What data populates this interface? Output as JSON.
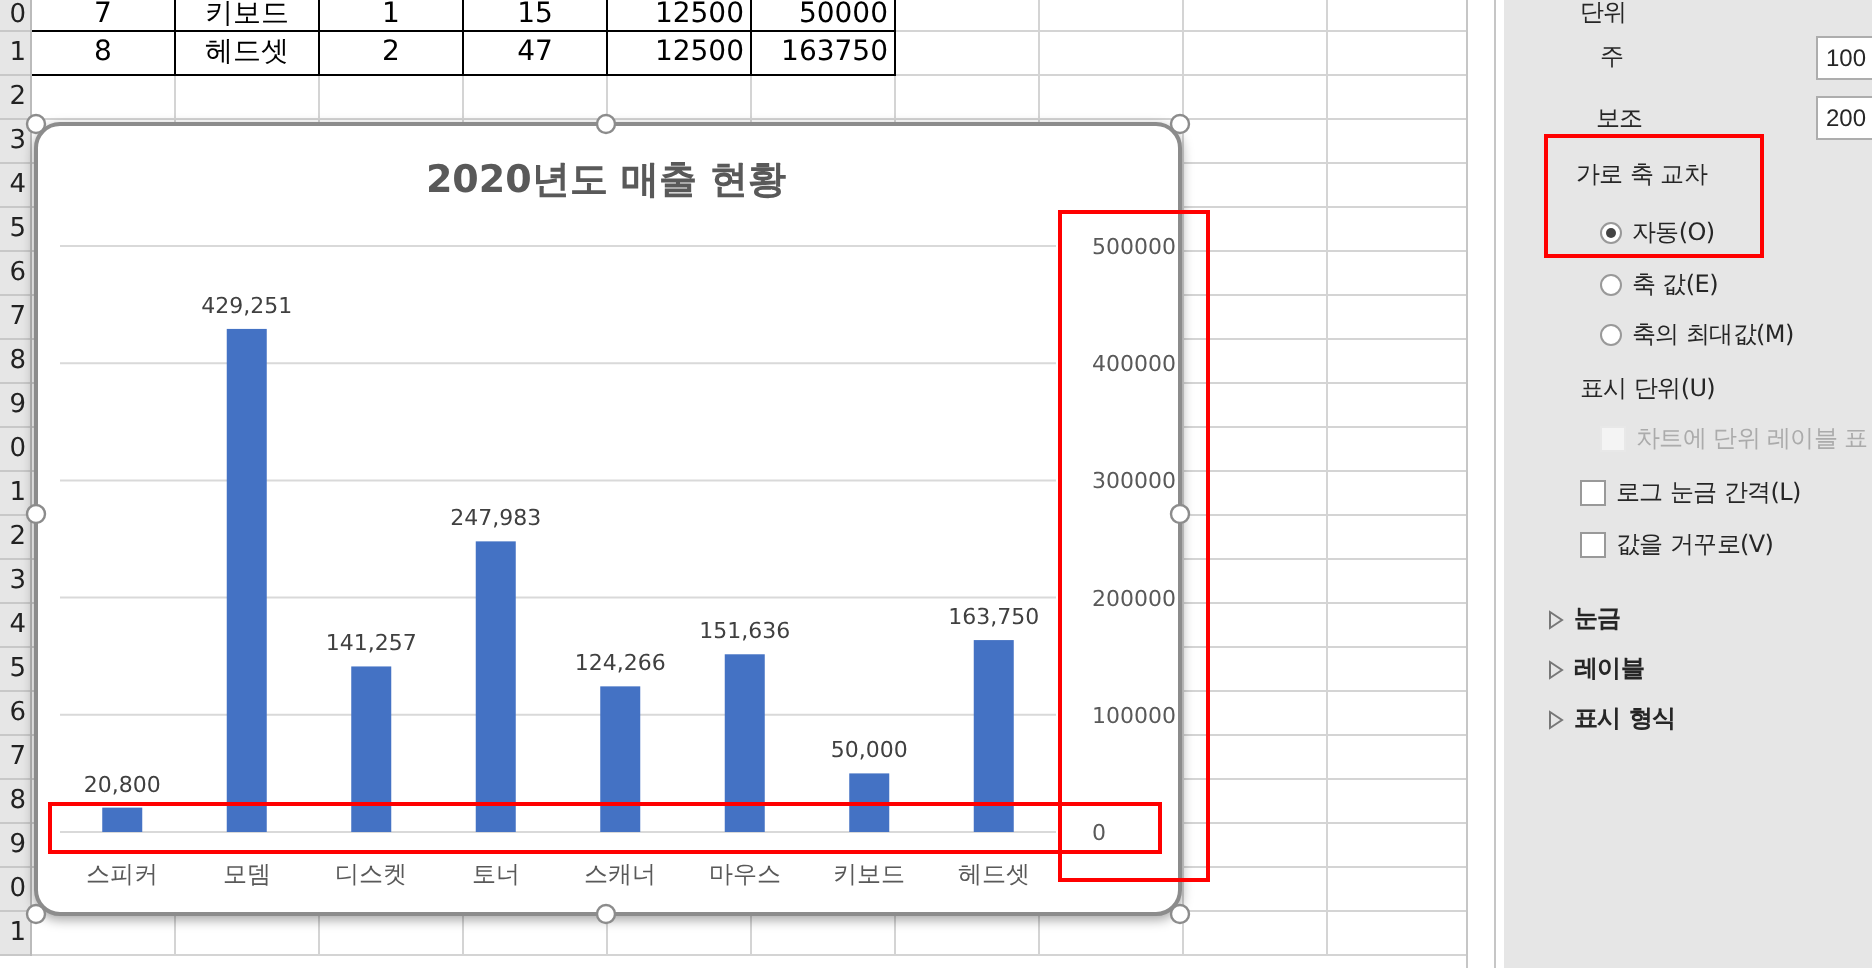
{
  "sheet": {
    "row_headers": [
      "0",
      "1",
      "2",
      "3",
      "4",
      "5",
      "6",
      "7",
      "8",
      "9",
      "0",
      "1",
      "2",
      "3",
      "4",
      "5",
      "6",
      "7",
      "8",
      "9",
      "0",
      "1"
    ],
    "rows": [
      [
        "7",
        "키보드",
        "1",
        "15",
        "12500",
        "50000"
      ],
      [
        "8",
        "헤드셋",
        "2",
        "47",
        "12500",
        "163750"
      ]
    ]
  },
  "chart": {
    "chart_data": {
      "type": "bar",
      "title": "2020년도 매출 현황",
      "categories": [
        "스피커",
        "모뎀",
        "디스켓",
        "토너",
        "스캐너",
        "마우스",
        "키보드",
        "헤드셋"
      ],
      "grid": true,
      "series": [
        {
          "color": "#4472c4",
          "values": [
            20800,
            429251,
            141257,
            247983,
            124266,
            151636,
            50000,
            163750
          ]
        }
      ],
      "ylim": [
        0,
        500000
      ],
      "yticks": [
        0,
        100000,
        200000,
        300000,
        400000,
        500000
      ],
      "value_labels": [
        "20,800",
        "429,251",
        "141,257",
        "247,983",
        "124,266",
        "151,636",
        "50,000",
        "163,750"
      ]
    }
  },
  "panel": {
    "section_label": "단위",
    "fields": [
      {
        "label": "주",
        "value": "100"
      },
      {
        "label": "보조",
        "value": "200"
      }
    ],
    "crosses": {
      "label": "가로 축 교차",
      "options": [
        {
          "label": "자동(O)",
          "selected": true
        },
        {
          "label": "축 값(E)",
          "selected": false
        },
        {
          "label": "축의 최대값(M)",
          "selected": false
        }
      ]
    },
    "display_units_label": "표시 단위(U)",
    "checkboxes": [
      {
        "label": "차트에 단위 레이블 표",
        "checked": false,
        "disabled": true
      },
      {
        "label": "로그 눈금 간격(L)",
        "checked": false,
        "disabled": false
      },
      {
        "label": "값을 거꾸로(V)",
        "checked": false,
        "disabled": false
      }
    ],
    "sections": [
      {
        "label": "눈금",
        "expanded": false
      },
      {
        "label": "레이블",
        "expanded": false
      },
      {
        "label": "표시 형식",
        "expanded": false
      }
    ]
  }
}
